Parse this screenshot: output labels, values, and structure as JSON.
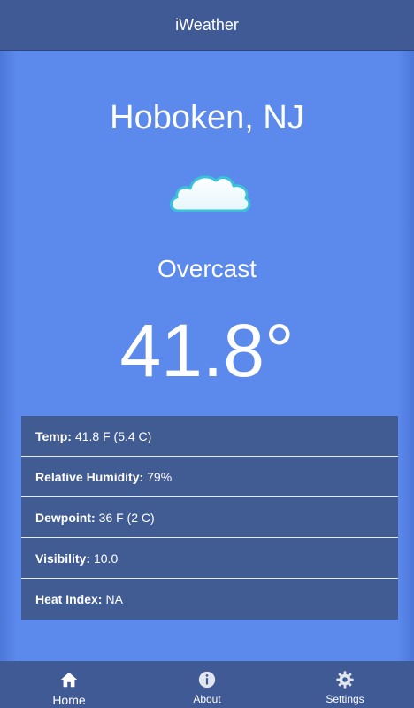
{
  "header": {
    "title": "iWeather"
  },
  "location": {
    "city": "Hoboken, NJ"
  },
  "current": {
    "icon": "cloud-icon",
    "condition": "Overcast",
    "temperature": "41.8°"
  },
  "details": [
    {
      "label": "Temp:",
      "value": "41.8 F (5.4 C)"
    },
    {
      "label": "Relative Humidity:",
      "value": "79%"
    },
    {
      "label": "Dewpoint:",
      "value": "36 F (2 C)"
    },
    {
      "label": "Visibility:",
      "value": "10.0"
    },
    {
      "label": "Heat Index:",
      "value": "NA"
    }
  ],
  "nav": {
    "tabs": [
      {
        "label": "Home",
        "icon": "home-icon",
        "active": true
      },
      {
        "label": "About",
        "icon": "info-icon",
        "active": false
      },
      {
        "label": "Settings",
        "icon": "gear-icon",
        "active": false
      }
    ]
  },
  "colors": {
    "background": "#5b89ec",
    "header": "#3f5a95",
    "details_panel": "#415b93",
    "text": "#ffffff"
  }
}
